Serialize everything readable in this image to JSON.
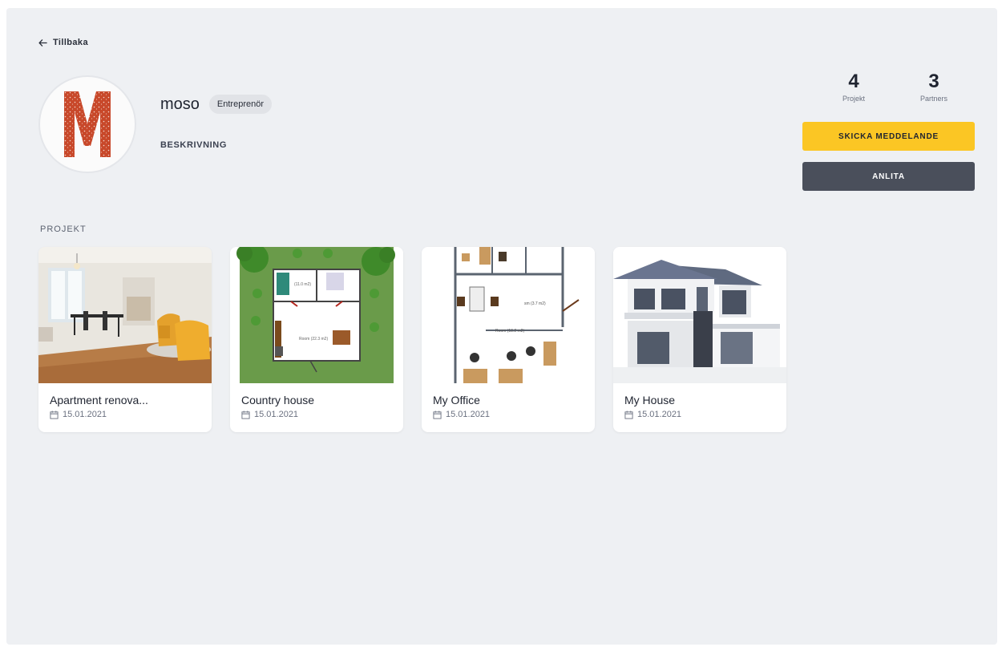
{
  "nav": {
    "back_label": "Tillbaka"
  },
  "profile": {
    "name": "moso",
    "role_badge": "Entreprenör",
    "description_label": "BESKRIVNING",
    "avatar_letter": "M"
  },
  "stats": [
    {
      "value": "4",
      "label": "Projekt"
    },
    {
      "value": "3",
      "label": "Partners"
    }
  ],
  "actions": {
    "send_message_label": "SKICKA MEDDELANDE",
    "hire_label": "ANLITA"
  },
  "projects_section": {
    "title": "PROJEKT",
    "items": [
      {
        "title": "Apartment renova...",
        "date": "15.01.2021",
        "thumbnail": "apartment-photo"
      },
      {
        "title": "Country house",
        "date": "15.01.2021",
        "thumbnail": "country-house-floorplan"
      },
      {
        "title": "My Office",
        "date": "15.01.2021",
        "thumbnail": "office-floorplan"
      },
      {
        "title": "My House",
        "date": "15.01.2021",
        "thumbnail": "house-render"
      }
    ]
  },
  "colors": {
    "accent_yellow": "#fbc624",
    "dark_button": "#4a4f5b",
    "page_background": "#eef0f3",
    "avatar_letter": "#c8482a"
  }
}
